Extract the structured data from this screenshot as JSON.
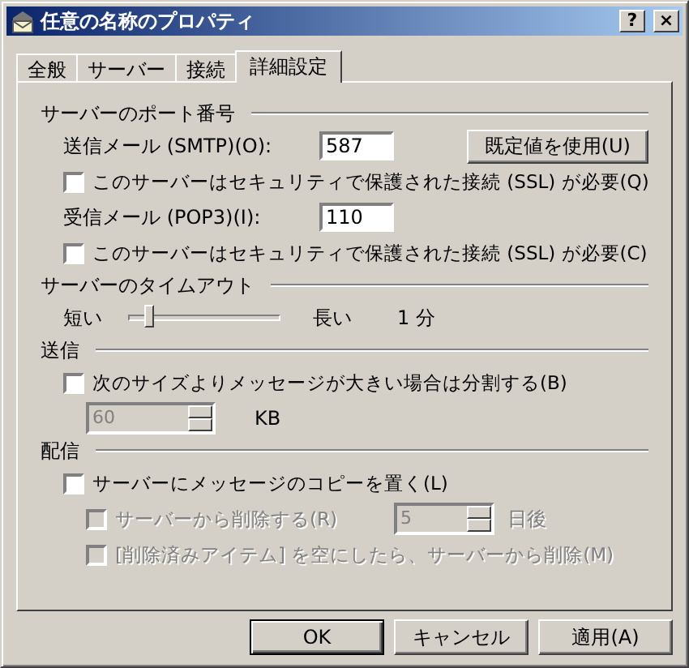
{
  "window": {
    "title": "任意の名称のプロパティ",
    "help_button": "?",
    "close_button": "×"
  },
  "tabs": [
    {
      "label": "全般",
      "selected": false
    },
    {
      "label": "サーバー",
      "selected": false
    },
    {
      "label": "接続",
      "selected": false
    },
    {
      "label": "詳細設定",
      "selected": true
    }
  ],
  "port_numbers": {
    "heading": "サーバーのポート番号",
    "smtp": {
      "label": "送信メール (SMTP)(O):",
      "value": "587"
    },
    "default_button": "既定値を使用(U)",
    "smtp_ssl": {
      "label": "このサーバーはセキュリティで保護された接続 (SSL) が必要(Q)",
      "checked": false
    },
    "pop3": {
      "label": "受信メール (POP3)(I):",
      "value": "110"
    },
    "pop3_ssl": {
      "label": "このサーバーはセキュリティで保護された接続 (SSL) が必要(C)",
      "checked": false
    }
  },
  "timeout": {
    "heading": "サーバーのタイムアウト",
    "short_label": "短い",
    "long_label": "長い",
    "level": 0.1,
    "reading": "1 分"
  },
  "sending": {
    "heading": "送信",
    "split": {
      "label": "次のサイズよりメッセージが大きい場合は分割する(B)",
      "checked": false
    },
    "size": {
      "value": "60",
      "disabled": true
    },
    "unit": "KB"
  },
  "delivery": {
    "heading": "配信",
    "leave_copy": {
      "label": "サーバーにメッセージのコピーを置く(L)",
      "checked": false
    },
    "delete_after": {
      "label": "サーバーから削除する(R)",
      "checked": false,
      "disabled": true
    },
    "days": {
      "value": "5",
      "disabled": true
    },
    "days_unit": "日後",
    "delete_when_emptied": {
      "label": "[削除済みアイテム] を空にしたら、サーバーから削除(M)",
      "checked": false,
      "disabled": true
    }
  },
  "buttons": [
    {
      "label": "OK",
      "default": true
    },
    {
      "label": "キャンセル",
      "default": false
    },
    {
      "label": "適用(A)",
      "default": false
    }
  ]
}
